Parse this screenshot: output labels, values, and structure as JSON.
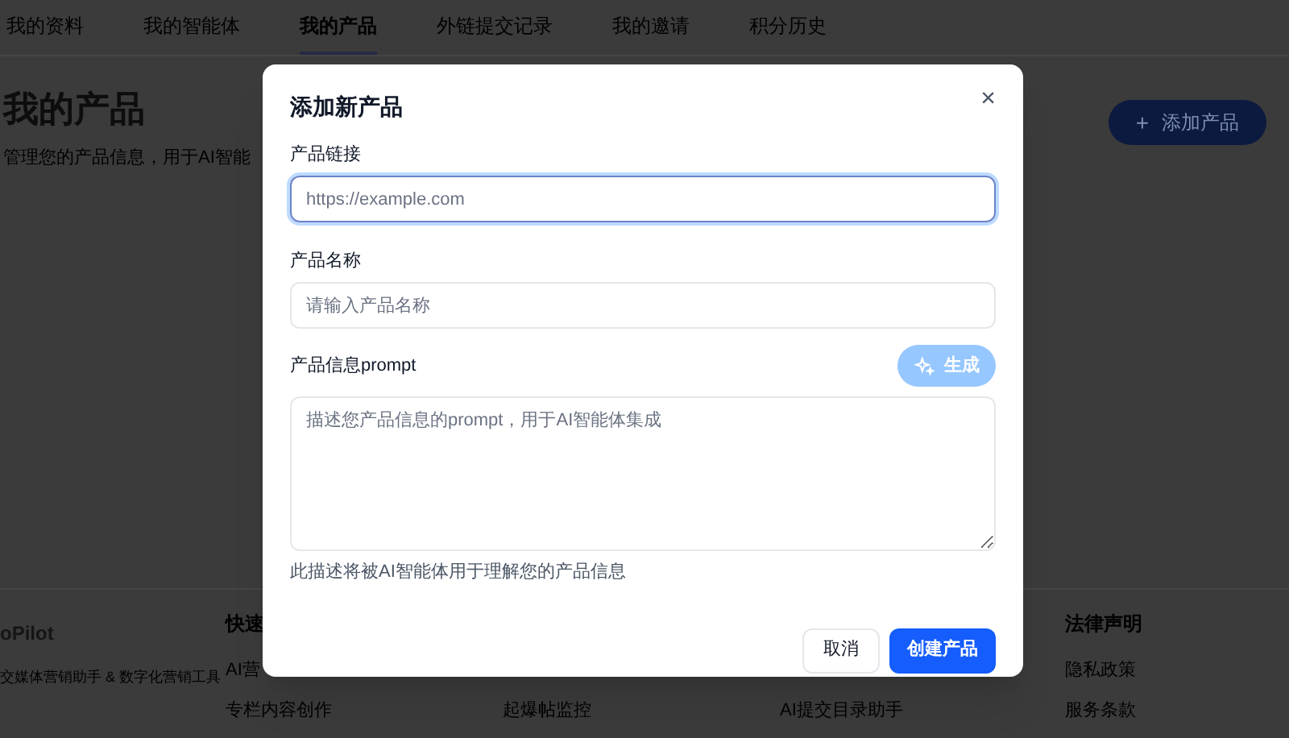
{
  "nav": {
    "tabs": [
      {
        "label": "我的资料",
        "selected": false
      },
      {
        "label": "我的智能体",
        "selected": false
      },
      {
        "label": "我的产品",
        "selected": true
      },
      {
        "label": "外链提交记录",
        "selected": false
      },
      {
        "label": "我的邀请",
        "selected": false
      },
      {
        "label": "积分历史",
        "selected": false
      }
    ]
  },
  "page": {
    "title": "我的产品",
    "subtitle": "管理您的产品信息，用于AI智能",
    "add_button": {
      "icon": "+",
      "label": "添加产品"
    }
  },
  "footer": {
    "brand": "oPilot",
    "tagline": "交媒体营销助手 & 数字化营销工具",
    "columns": [
      {
        "heading": "快速",
        "links": [
          "AI营",
          "专栏内容创作"
        ]
      },
      {
        "links": [
          "起爆帖监控"
        ]
      },
      {
        "links": [
          "AI提交目录助手"
        ]
      },
      {
        "heading": "法律声明",
        "links": [
          "隐私政策",
          "服务条款"
        ]
      }
    ]
  },
  "modal": {
    "title": "添加新产品",
    "close": "×",
    "fields": [
      {
        "kind": "input",
        "label": "产品链接",
        "placeholder": "https://example.com",
        "focused": true
      },
      {
        "kind": "input",
        "label": "产品名称",
        "placeholder": "请输入产品名称",
        "focused": false
      },
      {
        "kind": "textarea",
        "label": "产品信息prompt",
        "placeholder": "描述您产品信息的prompt，用于AI智能体集成",
        "focused": false,
        "generate_button": {
          "label": "生成",
          "disabled": true
        }
      }
    ],
    "help": "此描述将被AI智能体用于理解您的产品信息",
    "cancel_button": "取消",
    "create_button": "创建产品"
  }
}
